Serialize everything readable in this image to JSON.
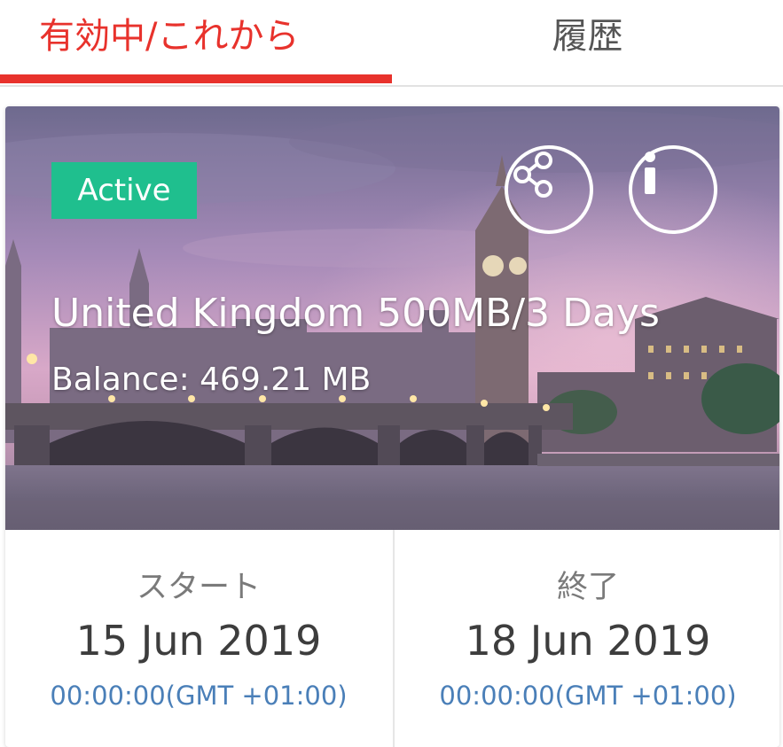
{
  "tabs": {
    "active_label": "有効中/これから",
    "history_label": "履歴"
  },
  "card": {
    "status_badge": "Active",
    "plan_title": "United Kingdom 500MB/3 Days",
    "balance": "Balance: 469.21 MB",
    "icons": [
      "share-icon",
      "info-icon"
    ],
    "start": {
      "label": "スタート",
      "date": "15 Jun 2019",
      "time": "00:00:00(GMT +01:00)"
    },
    "end": {
      "label": "終了",
      "date": "18 Jun 2019",
      "time": "00:00:00(GMT +01:00)"
    }
  },
  "colors": {
    "accent": "#e8322c",
    "badge": "#1fbf8e",
    "time_text": "#4a7fb8"
  }
}
